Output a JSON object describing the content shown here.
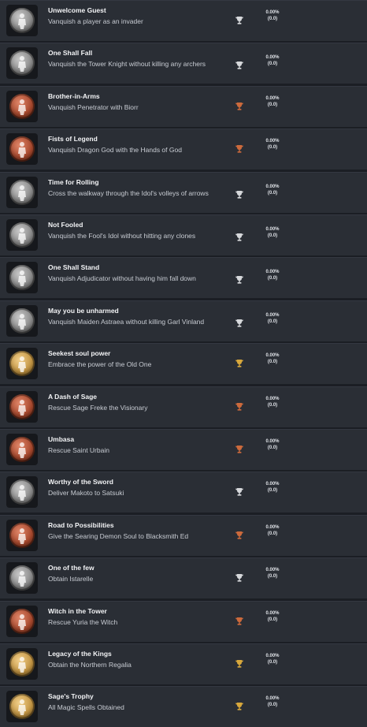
{
  "colors": {
    "silver": "#d6d8db",
    "bronze": "#cc6a3c",
    "gold": "#d8a83c"
  },
  "achievements": [
    {
      "title": "Unwelcome Guest",
      "description": "Vanquish a player as an invader",
      "trophy": "silver",
      "percent": "0.00%",
      "count": "(0.0)",
      "badge_icon": "invader-figure-icon"
    },
    {
      "title": "One Shall Fall",
      "description": "Vanquish the Tower Knight without killing any archers",
      "trophy": "silver",
      "percent": "0.00%",
      "count": "(0.0)",
      "badge_icon": "knight-figure-icon"
    },
    {
      "title": "Brother-in-Arms",
      "description": "Vanquish Penetrator with Biorr",
      "trophy": "bronze",
      "percent": "0.00%",
      "count": "(0.0)",
      "badge_icon": "warrior-figure-icon"
    },
    {
      "title": "Fists of Legend",
      "description": "Vanquish Dragon God with the Hands of God",
      "trophy": "bronze",
      "percent": "0.00%",
      "count": "(0.0)",
      "badge_icon": "fist-figure-icon"
    },
    {
      "title": "Time for Rolling",
      "description": "Cross the walkway through the Idol's volleys of arrows",
      "trophy": "silver",
      "percent": "0.00%",
      "count": "(0.0)",
      "badge_icon": "rolling-figure-icon"
    },
    {
      "title": "Not Fooled",
      "description": "Vanquish the Fool's Idol without hitting any clones",
      "trophy": "silver",
      "percent": "0.00%",
      "count": "(0.0)",
      "badge_icon": "idol-figure-icon"
    },
    {
      "title": "One Shall Stand",
      "description": "Vanquish Adjudicator without having him fall down",
      "trophy": "silver",
      "percent": "0.00%",
      "count": "(0.0)",
      "badge_icon": "adjudicator-figure-icon"
    },
    {
      "title": "May you be unharmed",
      "description": "Vanquish Maiden Astraea without killing Garl Vinland",
      "trophy": "silver",
      "percent": "0.00%",
      "count": "(0.0)",
      "badge_icon": "maiden-figure-icon"
    },
    {
      "title": "Seekest soul power",
      "description": "Embrace the power of the Old One",
      "trophy": "gold",
      "percent": "0.00%",
      "count": "(0.0)",
      "badge_icon": "soul-figure-icon"
    },
    {
      "title": "A Dash of Sage",
      "description": "Rescue Sage Freke the Visionary",
      "trophy": "bronze",
      "percent": "0.00%",
      "count": "(0.0)",
      "badge_icon": "sage-figure-icon"
    },
    {
      "title": "Umbasa",
      "description": "Rescue Saint Urbain",
      "trophy": "bronze",
      "percent": "0.00%",
      "count": "(0.0)",
      "badge_icon": "saint-figure-icon"
    },
    {
      "title": "Worthy of the Sword",
      "description": "Deliver Makoto to Satsuki",
      "trophy": "silver",
      "percent": "0.00%",
      "count": "(0.0)",
      "badge_icon": "sword-figure-icon"
    },
    {
      "title": "Road to Possibilities",
      "description": "Give the Searing Demon Soul to Blacksmith Ed",
      "trophy": "bronze",
      "percent": "0.00%",
      "count": "(0.0)",
      "badge_icon": "blacksmith-figure-icon"
    },
    {
      "title": "One of the few",
      "description": "Obtain Istarelle",
      "trophy": "silver",
      "percent": "0.00%",
      "count": "(0.0)",
      "badge_icon": "spear-figure-icon"
    },
    {
      "title": "Witch in the Tower",
      "description": "Rescue Yuria the Witch",
      "trophy": "bronze",
      "percent": "0.00%",
      "count": "(0.0)",
      "badge_icon": "witch-figure-icon"
    },
    {
      "title": "Legacy of the Kings",
      "description": "Obtain the Northern Regalia",
      "trophy": "gold",
      "percent": "0.00%",
      "count": "(0.0)",
      "badge_icon": "regalia-figure-icon"
    },
    {
      "title": "Sage's Trophy",
      "description": "All Magic Spells Obtained",
      "trophy": "gold",
      "percent": "0.00%",
      "count": "(0.0)",
      "badge_icon": "spellbook-figure-icon"
    }
  ]
}
